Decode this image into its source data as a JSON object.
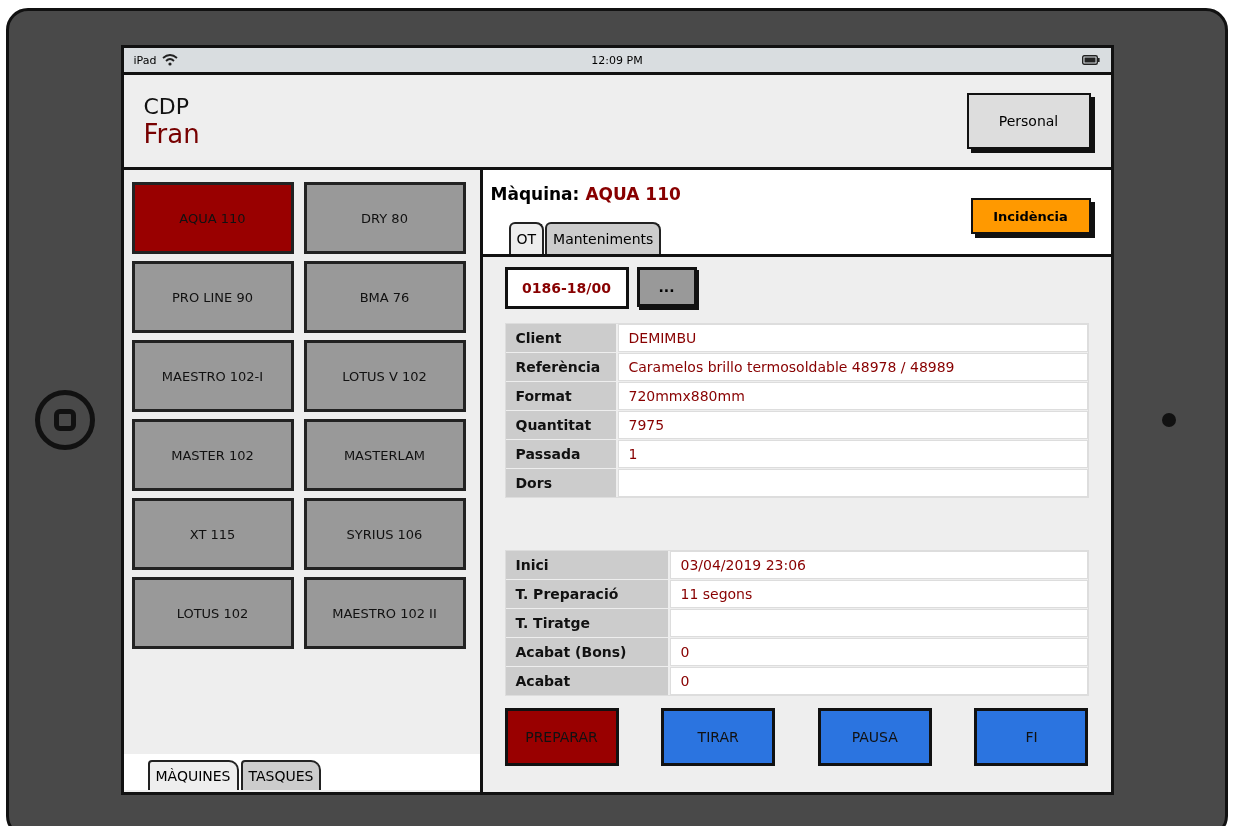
{
  "status_bar": {
    "device": "iPad",
    "time": "12:09 PM"
  },
  "header": {
    "title": "CDP",
    "user": "Fran",
    "button": "Personal"
  },
  "machines": [
    {
      "label": "AQUA 110",
      "selected": true
    },
    {
      "label": "DRY 80",
      "selected": false
    },
    {
      "label": "PRO LINE 90",
      "selected": false
    },
    {
      "label": "BMA 76",
      "selected": false
    },
    {
      "label": "MAESTRO 102-I",
      "selected": false
    },
    {
      "label": "LOTUS V 102",
      "selected": false
    },
    {
      "label": "MASTER 102",
      "selected": false
    },
    {
      "label": "MASTERLAM",
      "selected": false
    },
    {
      "label": "XT 115",
      "selected": false
    },
    {
      "label": "SYRIUS 106",
      "selected": false
    },
    {
      "label": "LOTUS 102",
      "selected": false
    },
    {
      "label": "MAESTRO 102 II",
      "selected": false
    }
  ],
  "left_tabs": [
    {
      "label": "MÀQUINES",
      "selected": true
    },
    {
      "label": "TASQUES",
      "selected": false
    }
  ],
  "detail": {
    "machine_label": "Màquina:",
    "machine_name": "AQUA 110",
    "incident_button": "Incidència",
    "tabs": [
      {
        "label": "OT",
        "selected": true
      },
      {
        "label": "Manteniments",
        "selected": false
      }
    ],
    "order_number": "0186-18/00",
    "more_button": "...",
    "ot_fields": [
      {
        "label": "Client",
        "value": "DEMIMBU"
      },
      {
        "label": "Referència",
        "value": "Caramelos brillo termosoldable 48978 / 48989"
      },
      {
        "label": "Format",
        "value": "720mmx880mm"
      },
      {
        "label": "Quantitat",
        "value": "7975"
      },
      {
        "label": "Passada",
        "value": "1"
      },
      {
        "label": "Dors"
      }
    ],
    "time_fields": [
      {
        "label": "Inici",
        "value": "03/04/2019 23:06"
      },
      {
        "label": "T. Preparació",
        "value": "11 segons"
      },
      {
        "label": "T. Tiratge"
      },
      {
        "label": "Acabat (Bons)",
        "value": "0"
      },
      {
        "label": "Acabat",
        "value": "0"
      }
    ],
    "actions": [
      {
        "label": "PREPARAR",
        "color": "#990000"
      },
      {
        "label": "TIRAR",
        "color": "#2b74e0"
      },
      {
        "label": "PAUSA",
        "color": "#2b74e0"
      },
      {
        "label": "FI",
        "color": "#2b74e0"
      }
    ]
  }
}
